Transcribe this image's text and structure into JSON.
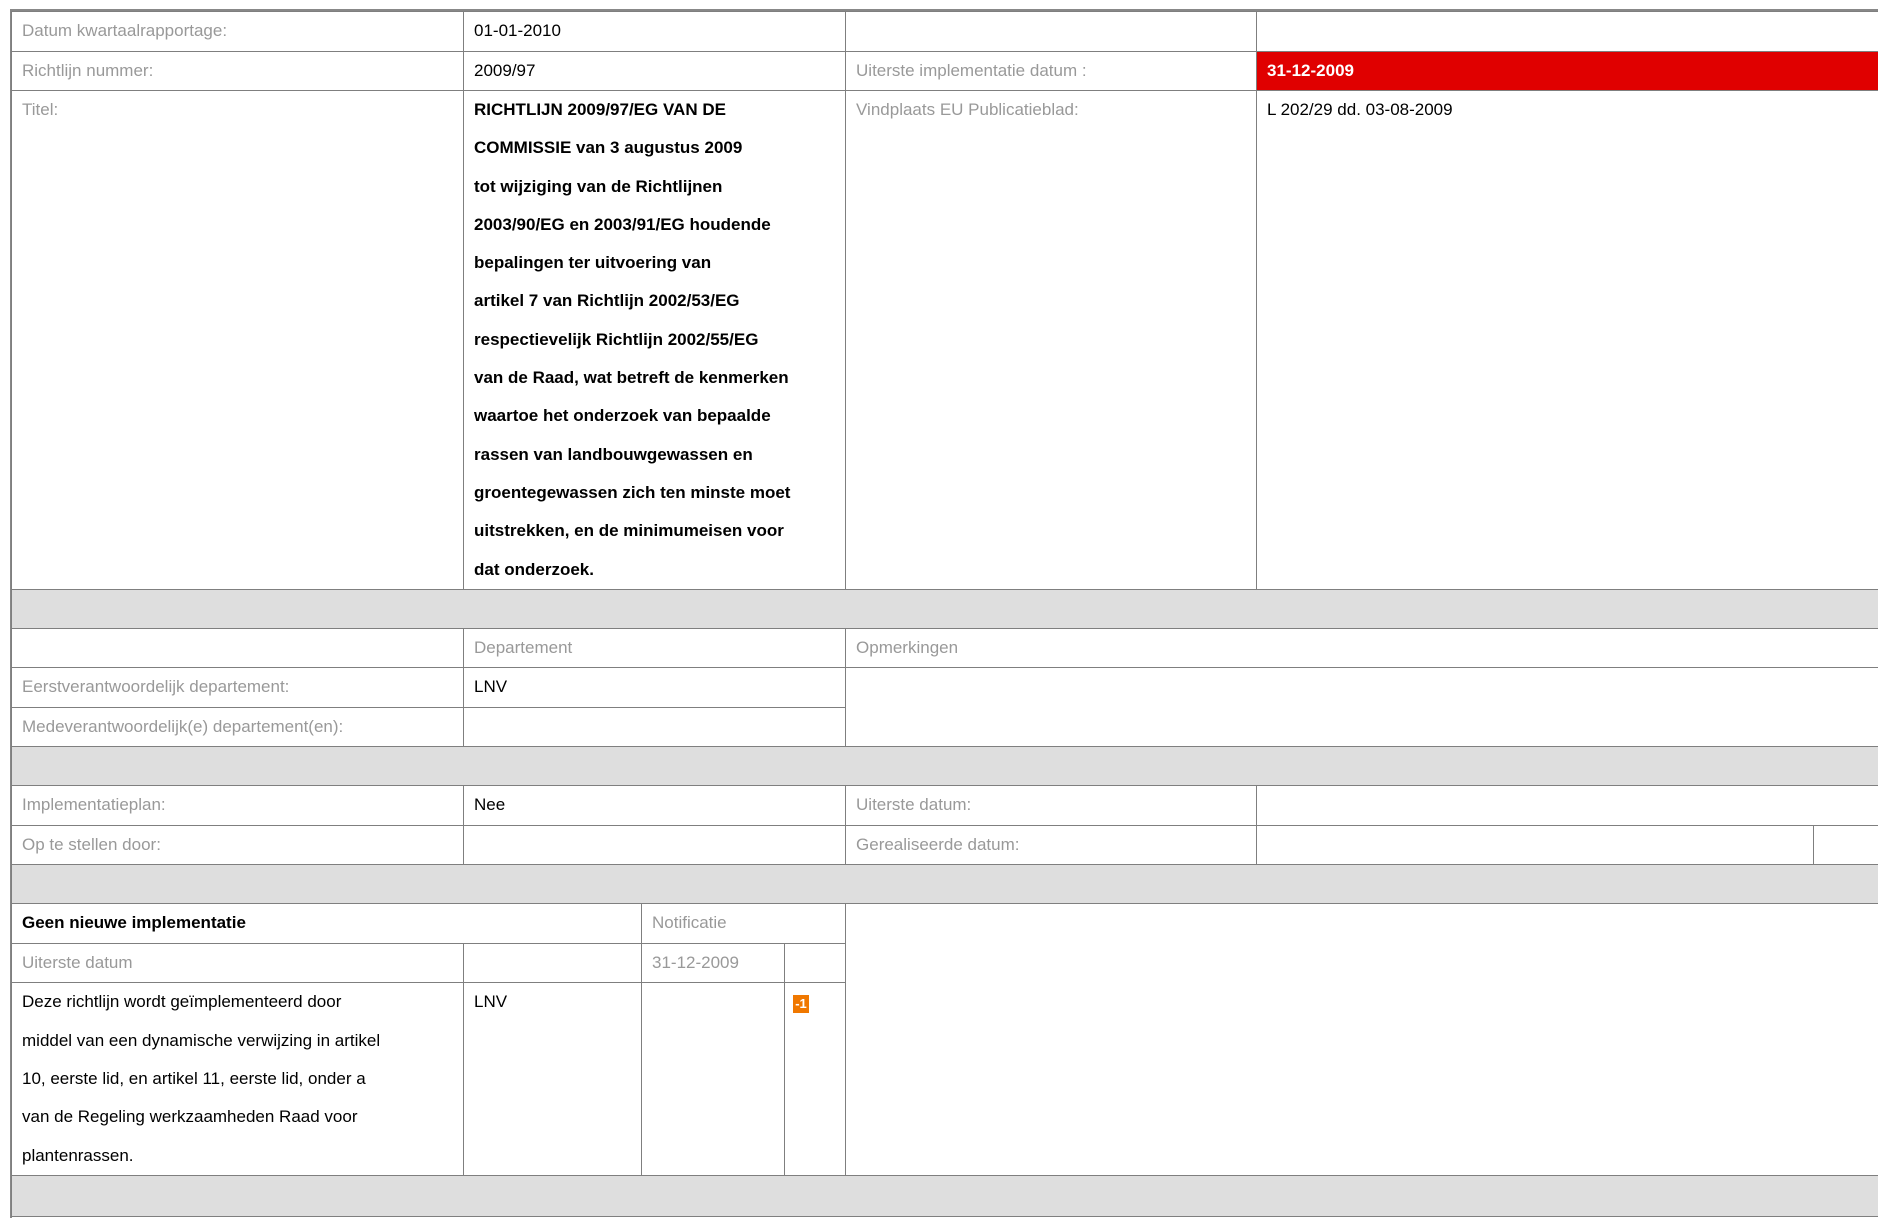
{
  "header": {
    "datum_label": "Datum kwartaalrapportage:",
    "datum_value": "01-01-2010",
    "richtlijn_label": "Richtlijn nummer:",
    "richtlijn_value": "2009/97",
    "uiterste_impl_label": "Uiterste implementatie datum :",
    "uiterste_impl_value": "31-12-2009",
    "titel_label": "Titel:",
    "titel_lines": [
      "RICHTLIJN 2009/97/EG VAN DE",
      "COMMISSIE van 3 augustus 2009",
      "tot wijziging van de Richtlijnen",
      "2003/90/EG en 2003/91/EG houdende",
      "bepalingen ter uitvoering van",
      "artikel 7 van Richtlijn 2002/53/EG",
      "respectievelijk Richtlijn 2002/55/EG",
      "van de Raad, wat betreft de kenmerken",
      "waartoe het onderzoek van bepaalde",
      "rassen van landbouwgewassen en",
      "groentegewassen zich ten minste moet",
      "uitstrekken, en de minimumeisen voor",
      "dat onderzoek."
    ],
    "vindplaats_label": "Vindplaats EU Publicatieblad:",
    "vindplaats_value": "L 202/29 dd. 03-08-2009"
  },
  "departments": {
    "col_departement": "Departement",
    "col_opmerkingen": "Opmerkingen",
    "eerst_label": "Eerstverantwoordelijk departement:",
    "eerst_value": "LNV",
    "mede_label": "Medeverantwoordelijk(e) departement(en):",
    "mede_value": ""
  },
  "plan": {
    "impl_label": "Implementatieplan:",
    "impl_value": "Nee",
    "uiterste_label": "Uiterste datum:",
    "uiterste_value": "",
    "opstellen_label": "Op te stellen door:",
    "opstellen_value": "",
    "gerealiseerd_label": "Gerealiseerde datum:",
    "gerealiseerd_value": ""
  },
  "implementation": {
    "heading": "Geen nieuwe implementatie",
    "notificatie_label": "Notificatie",
    "uiterste_label": "Uiterste datum",
    "uiterste_value": "31-12-2009",
    "description_lines": [
      "Deze richtlijn wordt geïmplementeerd door",
      "middel van een dynamische verwijzing in artikel",
      "10, eerste lid, en artikel 11, eerste lid, onder a",
      "van de  Regeling werkzaamheden Raad voor",
      "plantenrassen."
    ],
    "department": "LNV",
    "icon_glyph": "-1"
  },
  "colors": {
    "deadline_red": "#e00000",
    "separator": "#dedede",
    "label_gray": "#999999",
    "icon_orange": "#f07800"
  }
}
